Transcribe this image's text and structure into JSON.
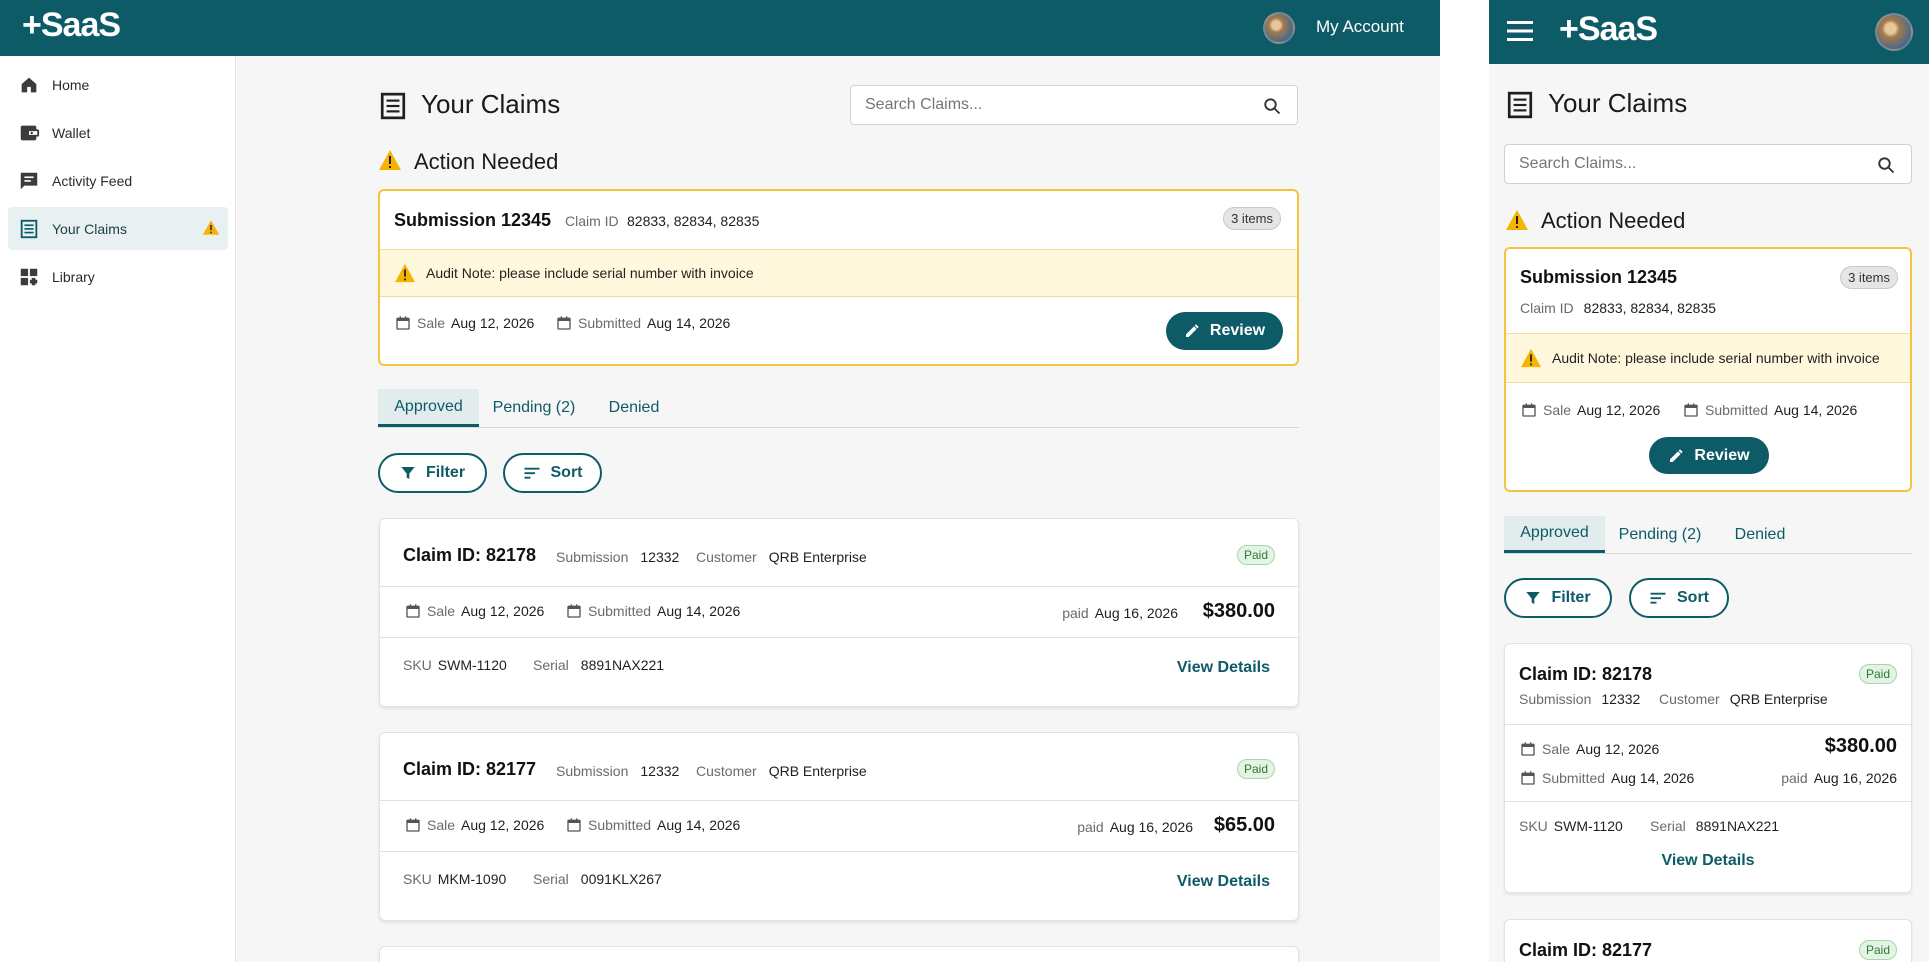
{
  "brand": {
    "logo": "+SaaS",
    "primary": "#0d5b66",
    "warning": "#f4c441"
  },
  "header": {
    "account_label": "My Account"
  },
  "sidebar": {
    "items": [
      {
        "label": "Home",
        "icon": "home-icon"
      },
      {
        "label": "Wallet",
        "icon": "wallet-icon"
      },
      {
        "label": "Activity Feed",
        "icon": "chat-icon"
      },
      {
        "label": "Your Claims",
        "icon": "claims-icon",
        "active": true
      },
      {
        "label": "Library",
        "icon": "dashboard-icon"
      }
    ]
  },
  "page": {
    "title": "Your Claims",
    "search_placeholder": "Search Claims..."
  },
  "action_needed": {
    "title": "Action Needed",
    "submission_title": "Submission 12345",
    "claim_id_label": "Claim ID",
    "claim_ids": "82833, 82834, 82835",
    "items_badge": "3 items",
    "audit_note": "Audit Note: please include serial number with invoice",
    "sale_label": "Sale",
    "sale_date": "Aug 12, 2026",
    "submitted_label": "Submitted",
    "submitted_date": "Aug 14, 2026",
    "review_label": "Review"
  },
  "tabs": [
    {
      "label": "Approved",
      "active": true
    },
    {
      "label": "Pending (2)"
    },
    {
      "label": "Denied"
    }
  ],
  "toolbar": {
    "filter_label": "Filter",
    "sort_label": "Sort"
  },
  "labels": {
    "submission": "Submission",
    "customer": "Customer",
    "sale": "Sale",
    "submitted": "Submitted",
    "paid": "paid",
    "sku": "SKU",
    "serial": "Serial",
    "view_details": "View Details"
  },
  "claims": [
    {
      "title": "Claim ID: 82178",
      "status": "Paid",
      "submission": "12332",
      "customer": "QRB Enterprise",
      "sale_date": "Aug 12, 2026",
      "submitted_date": "Aug 14, 2026",
      "paid_date": "Aug 16, 2026",
      "amount": "$380.00",
      "sku": "SWM-1120",
      "serial": "8891NAX221"
    },
    {
      "title": "Claim ID: 82177",
      "status": "Paid",
      "submission": "12332",
      "customer": "QRB Enterprise",
      "sale_date": "Aug 12, 2026",
      "submitted_date": "Aug 14, 2026",
      "paid_date": "Aug 16, 2026",
      "amount": "$65.00",
      "sku": "MKM-1090",
      "serial": "0091KLX267"
    }
  ]
}
